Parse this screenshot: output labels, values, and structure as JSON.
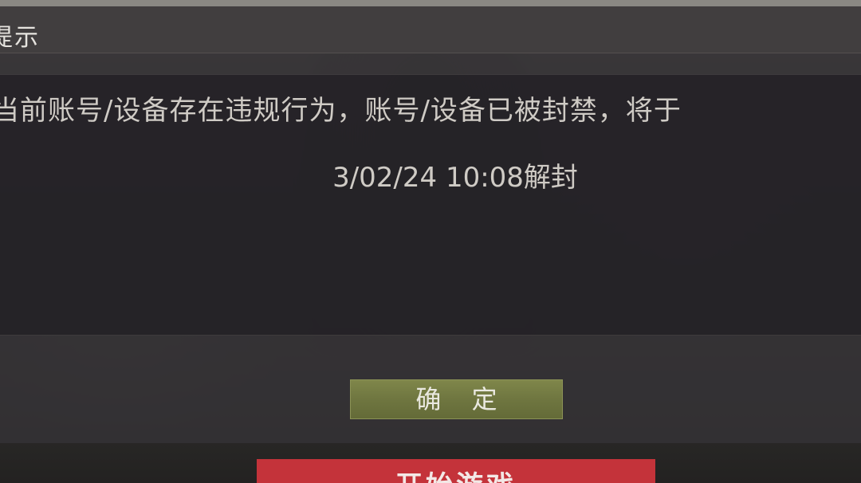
{
  "dialog": {
    "title": "提示",
    "message_line1": "当前账号/设备存在违规行为，账号/设备已被封禁，将于",
    "message_line2": "3/02/24 10:08解封",
    "confirm_label": "确 定"
  },
  "background": {
    "start_button_label": "开始游戏"
  },
  "colors": {
    "confirm_button": "#6f7640",
    "start_button": "#c4333a",
    "dialog_text": "#cfcbc5"
  }
}
